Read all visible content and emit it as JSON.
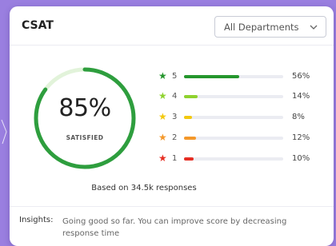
{
  "card": {
    "title": "CSAT"
  },
  "department_filter": {
    "selected": "All Departments",
    "icon": "chevron-down-icon"
  },
  "gauge": {
    "percent_label": "85%",
    "value": 85,
    "caption": "SATISFIED",
    "color": "#2e9e3e",
    "track_color": "#e2f3da"
  },
  "ratings": [
    {
      "stars": "5",
      "percent": "56%",
      "value": 56,
      "color": "#25962d",
      "star_color": "#25962d"
    },
    {
      "stars": "4",
      "percent": "14%",
      "value": 14,
      "color": "#8fd22f",
      "star_color": "#8fd22f"
    },
    {
      "stars": "3",
      "percent": "8%",
      "value": 8,
      "color": "#f3c90e",
      "star_color": "#f3c90e"
    },
    {
      "stars": "2",
      "percent": "12%",
      "value": 12,
      "color": "#f4982a",
      "star_color": "#f4982a"
    },
    {
      "stars": "1",
      "percent": "10%",
      "value": 10,
      "color": "#e62e23",
      "star_color": "#e62e23"
    }
  ],
  "summary": {
    "responses_text": "Based on 34.5k responses"
  },
  "insights": {
    "label": "Insights:",
    "text": "Going good so far. You can improve score by decreasing response time"
  }
}
